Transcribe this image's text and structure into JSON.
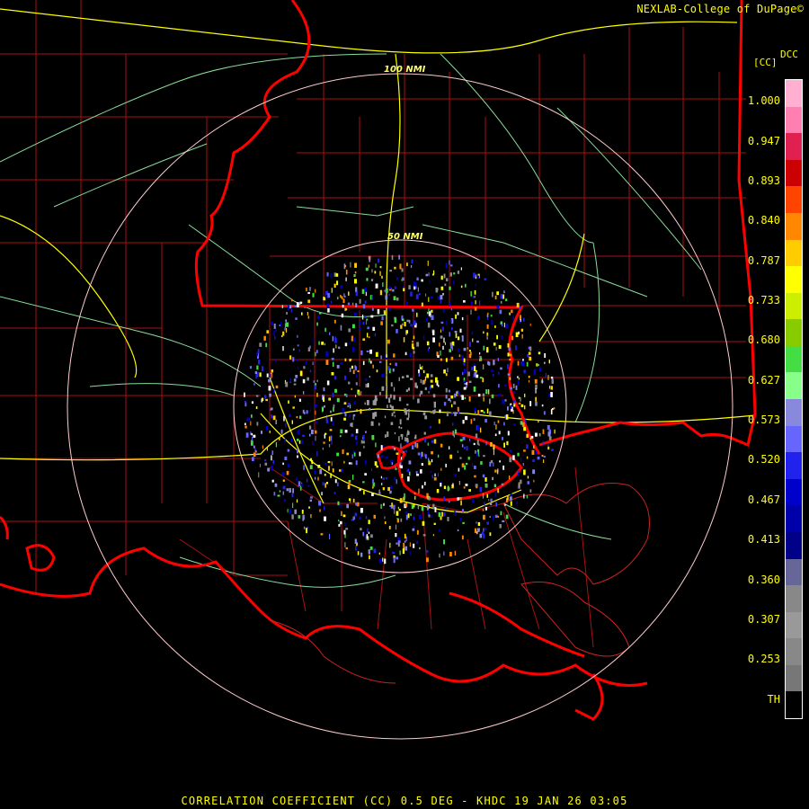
{
  "credit": "NEXLAB-College of DuPage©",
  "product": {
    "code": "DCC",
    "unit": "[CC]"
  },
  "status_bar": "CORRELATION COEFFICIENT (CC) 0.5 DEG - KHDC 19 JAN 26 03:05",
  "range_rings": [
    {
      "label": "100 NMI",
      "nmi": 100
    },
    {
      "label": "50 NMI",
      "nmi": 50
    }
  ],
  "scale": {
    "labels": [
      "1.000",
      "0.947",
      "0.893",
      "0.840",
      "0.787",
      "0.733",
      "0.680",
      "0.627",
      "0.573",
      "0.520",
      "0.467",
      "0.413",
      "0.360",
      "0.307",
      "0.253",
      "TH"
    ],
    "colors": [
      "#ffb0d0",
      "#ff80b0",
      "#e02050",
      "#cc0000",
      "#ff4400",
      "#ff8800",
      "#ffcc00",
      "#ffff00",
      "#ccee00",
      "#88cc00",
      "#44dd44",
      "#88ff88",
      "#8888dd",
      "#6666ff",
      "#2222ee",
      "#0000cc",
      "#0000aa",
      "#000088",
      "#666699",
      "#888888",
      "#999999",
      "#888888",
      "#777777",
      "#000000"
    ]
  },
  "colors": {
    "border_state": "#ff0000",
    "border_parish": "#aa1111",
    "highway": "#ffff00",
    "road": "#88dd99",
    "ring": "#ffcccc"
  }
}
